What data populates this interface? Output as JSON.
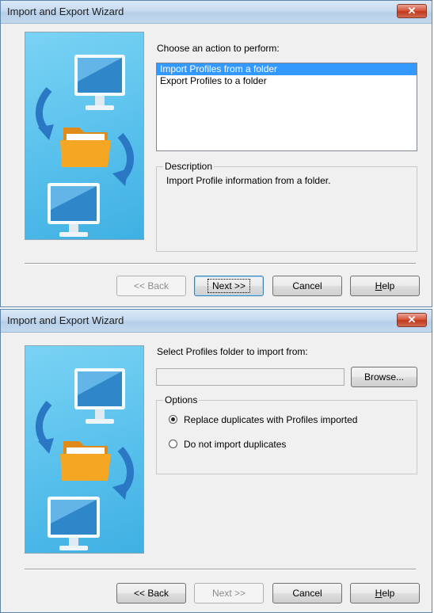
{
  "dialog1": {
    "title": "Import and Export Wizard",
    "close_glyph": "✕",
    "prompt": "Choose an action to perform:",
    "actions": [
      "Import Profiles from a folder",
      "Export Profiles to a folder"
    ],
    "selected_action": "Import Profiles from a folder",
    "description_legend": "Description",
    "description_text": "Import Profile information from a folder.",
    "buttons": {
      "back": "<< Back",
      "next": "Next >>",
      "cancel": "Cancel",
      "help_prefix": "H",
      "help_rest": "elp"
    },
    "back_enabled": false,
    "next_enabled": true
  },
  "dialog2": {
    "title": "Import and Export Wizard",
    "close_glyph": "✕",
    "prompt": "Select Profiles folder to import from:",
    "folder_path": "",
    "browse_label": "Browse...",
    "options_legend": "Options",
    "options": [
      {
        "label": "Replace duplicates with Profiles imported",
        "checked": true
      },
      {
        "label": "Do not import duplicates",
        "checked": false
      }
    ],
    "buttons": {
      "back": "<< Back",
      "next": "Next >>",
      "cancel": "Cancel",
      "help_prefix": "H",
      "help_rest": "elp"
    },
    "back_enabled": true,
    "next_enabled": false
  },
  "icons": [
    "monitor-icon",
    "arrow-icon",
    "folder-icon"
  ],
  "colors": {
    "accent": "#3399ff",
    "art_background": "#58c0ec",
    "folder": "#f5a623"
  }
}
